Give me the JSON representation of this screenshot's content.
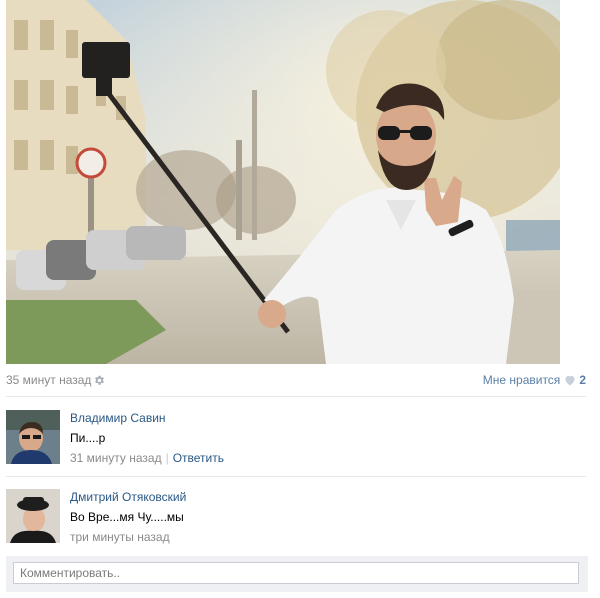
{
  "post": {
    "time": "35 минут назад",
    "settings_icon": "gear-icon",
    "like_label": "Мне нравится",
    "like_icon": "heart-icon",
    "like_count": "2"
  },
  "comments": [
    {
      "author": "Владимир Савин",
      "text": "Пи....р",
      "time": "31 минуту назад",
      "separator": "|",
      "reply_label": "Ответить"
    },
    {
      "author": "Дмитрий Отяковский",
      "text": "Во Вре...мя Чу.....мы",
      "time": "три минуты назад"
    }
  ],
  "comment_box": {
    "placeholder": "Комментировать.."
  },
  "colors": {
    "link": "#2a5885",
    "muted": "#8a8a8a",
    "divider": "#e7e8ec",
    "input_bar": "#eef0f3"
  }
}
